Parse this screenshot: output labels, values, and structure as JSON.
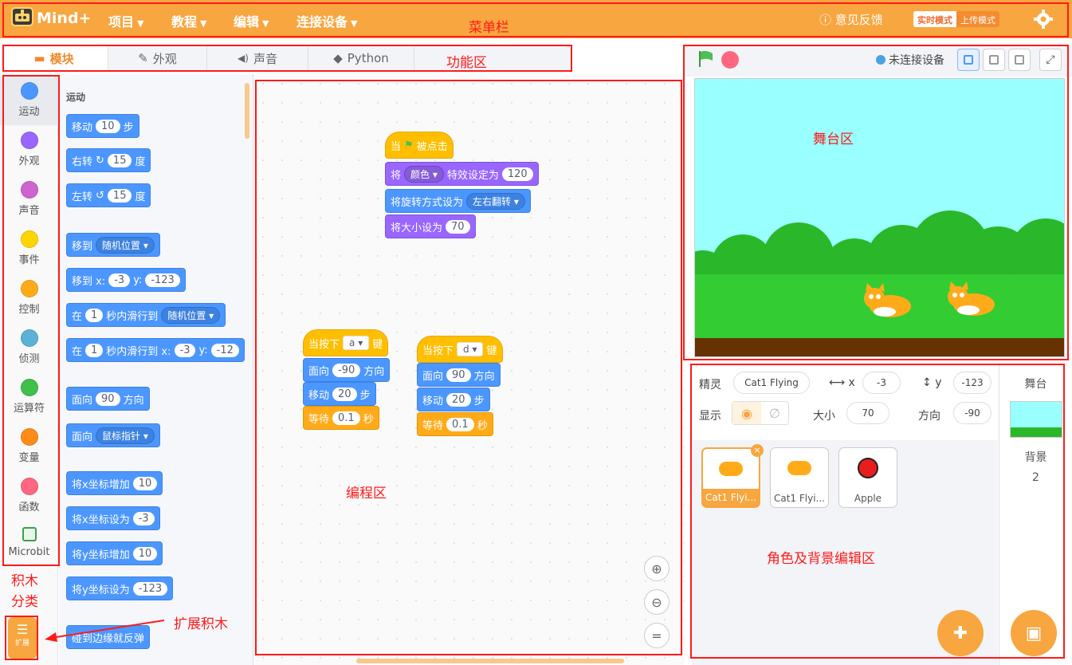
{
  "menubar": {
    "logo": "Mind+",
    "items": [
      "项目",
      "教程",
      "编辑",
      "连接设备"
    ],
    "feedback": "意见反馈",
    "mode_realtime": "实时模式",
    "mode_upload": "上传模式"
  },
  "tabs": [
    {
      "label": "模块",
      "icon": "puzzle-icon",
      "active": true
    },
    {
      "label": "外观",
      "icon": "brush-icon",
      "active": false
    },
    {
      "label": "声音",
      "icon": "speaker-icon",
      "active": false
    },
    {
      "label": "Python",
      "icon": "python-icon",
      "active": false
    }
  ],
  "categories": [
    {
      "label": "运动",
      "color": "#4c97ff"
    },
    {
      "label": "外观",
      "color": "#9966ff"
    },
    {
      "label": "声音",
      "color": "#cf63cf"
    },
    {
      "label": "事件",
      "color": "#ffd500"
    },
    {
      "label": "控制",
      "color": "#ffab19"
    },
    {
      "label": "侦测",
      "color": "#5cb1d6"
    },
    {
      "label": "运算符",
      "color": "#40bf4a"
    },
    {
      "label": "变量",
      "color": "#ff8c1a"
    },
    {
      "label": "函数",
      "color": "#ff6680"
    },
    {
      "label": "Microbit",
      "color": "#3ca04d"
    }
  ],
  "extension": {
    "label": "扩展"
  },
  "palette": {
    "title": "运动",
    "blocks": {
      "move": {
        "a": "移动",
        "v": "10",
        "b": "步"
      },
      "turn_right": {
        "a": "右转",
        "v": "15",
        "b": "度"
      },
      "turn_left": {
        "a": "左转",
        "v": "15",
        "b": "度"
      },
      "goto": {
        "a": "移到",
        "dd": "随机位置"
      },
      "goto_xy": {
        "a": "移到 x:",
        "x": "-3",
        "b": "y:",
        "y": "-123"
      },
      "glide": {
        "a": "在",
        "v": "1",
        "b": "秒内滑行到",
        "dd": "随机位置"
      },
      "glide_xy": {
        "a": "在",
        "v": "1",
        "b": "秒内滑行到 x:",
        "x": "-3",
        "c": "y:",
        "y": "-12"
      },
      "point": {
        "a": "面向",
        "v": "90",
        "b": "方向"
      },
      "point_to": {
        "a": "面向",
        "dd": "鼠标指针"
      },
      "change_x": {
        "a": "将x坐标增加",
        "v": "10"
      },
      "set_x": {
        "a": "将x坐标设为",
        "v": "-3"
      },
      "change_y": {
        "a": "将y坐标增加",
        "v": "10"
      },
      "set_y": {
        "a": "将y坐标设为",
        "v": "-123"
      },
      "bounce": {
        "a": "碰到边缘就反弹"
      }
    }
  },
  "script1": {
    "hat": {
      "a": "当",
      "b": "被点击"
    },
    "effect": {
      "a": "将",
      "dd": "颜色",
      "b": "特效设定为",
      "v": "120"
    },
    "rotation": {
      "a": "将旋转方式设为",
      "dd": "左右翻转"
    },
    "size": {
      "a": "将大小设为",
      "v": "70"
    }
  },
  "script2": {
    "hat": {
      "a": "当按下",
      "dd": "a",
      "b": "键"
    },
    "point": {
      "a": "面向",
      "v": "-90",
      "b": "方向"
    },
    "move": {
      "a": "移动",
      "v": "20",
      "b": "步"
    },
    "wait": {
      "a": "等待",
      "v": "0.1",
      "b": "秒"
    }
  },
  "script3": {
    "hat": {
      "a": "当按下",
      "dd": "d",
      "b": "键"
    },
    "point": {
      "a": "面向",
      "v": "90",
      "b": "方向"
    },
    "move": {
      "a": "移动",
      "v": "20",
      "b": "步"
    },
    "wait": {
      "a": "等待",
      "v": "0.1",
      "b": "秒"
    }
  },
  "stage": {
    "connection": "未连接设备"
  },
  "sprite_info": {
    "sprite_label": "精灵",
    "sprite_name": "Cat1 Flying",
    "x_label": "x",
    "x": "-3",
    "y_label": "y",
    "y": "-123",
    "show_label": "显示",
    "size_label": "大小",
    "size": "70",
    "direction_label": "方向",
    "direction": "-90"
  },
  "sprites": [
    {
      "name": "Cat1 Flyi...",
      "selected": true
    },
    {
      "name": "Cat1 Flyi...",
      "selected": false
    },
    {
      "name": "Apple",
      "selected": false
    }
  ],
  "backdrop": {
    "title": "舞台",
    "label": "背景",
    "count": "2"
  },
  "annotations": {
    "menu": "菜单栏",
    "func": "功能区",
    "stage": "舞台区",
    "code": "编程区",
    "sprite": "角色及背景编辑区",
    "cats_1": "积木",
    "cats_2": "分类",
    "ext": "扩展积木"
  }
}
